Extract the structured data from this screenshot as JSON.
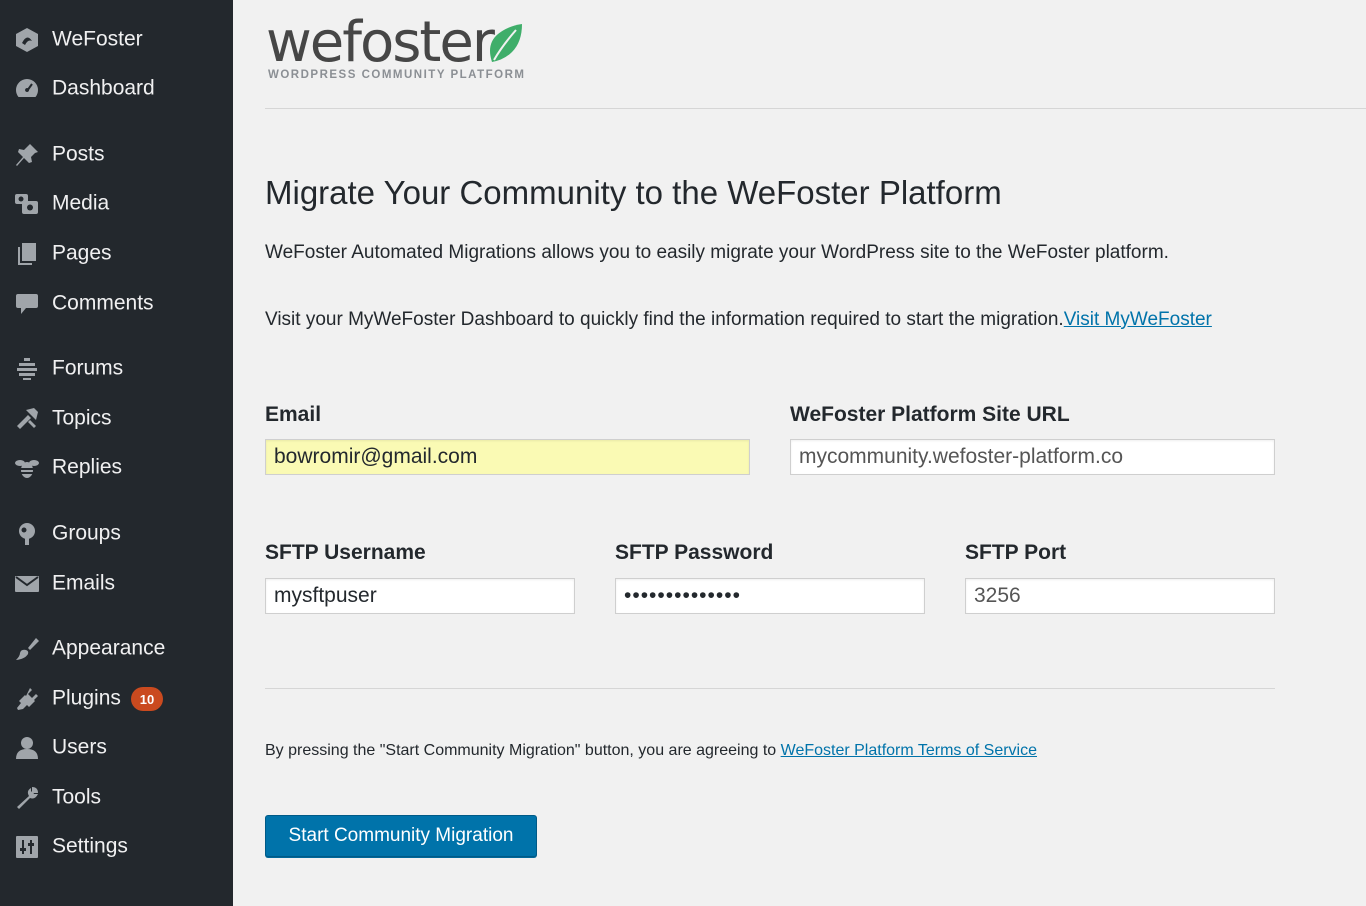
{
  "sidebar": {
    "items": [
      {
        "label": "WeFoster",
        "icon": "wefoster-hex-icon"
      },
      {
        "label": "Dashboard",
        "icon": "dashboard-gauge-icon"
      },
      {
        "label": "Posts",
        "icon": "pushpin-icon"
      },
      {
        "label": "Media",
        "icon": "media-camera-icon"
      },
      {
        "label": "Pages",
        "icon": "pages-icon"
      },
      {
        "label": "Comments",
        "icon": "comment-bubble-icon"
      },
      {
        "label": "Forums",
        "icon": "forums-stack-icon"
      },
      {
        "label": "Topics",
        "icon": "topics-tools-icon"
      },
      {
        "label": "Replies",
        "icon": "replies-bee-icon"
      },
      {
        "label": "Groups",
        "icon": "groups-icon"
      },
      {
        "label": "Emails",
        "icon": "envelope-icon"
      },
      {
        "label": "Appearance",
        "icon": "paintbrush-icon"
      },
      {
        "label": "Plugins",
        "icon": "plug-icon",
        "badge": "10"
      },
      {
        "label": "Users",
        "icon": "user-icon"
      },
      {
        "label": "Tools",
        "icon": "wrench-icon"
      },
      {
        "label": "Settings",
        "icon": "settings-sliders-icon"
      }
    ],
    "colors": {
      "background": "#23282d",
      "icon": "#a0a5aa",
      "text": "#f0f0f1",
      "badge": "#ca4a1f"
    }
  },
  "logo": {
    "wordmark": "wefoster",
    "tagline": "WORDPRESS COMMUNITY PLATFORM",
    "leaf_color": "#3fae6a"
  },
  "main": {
    "title": "Migrate Your Community to the WeFoster Platform",
    "intro": "WeFoster Automated Migrations allows you to easily migrate your WordPress site to the WeFoster platform.",
    "visit_text": "Visit your MyWeFoster Dashboard to quickly find the information required to start the migration.",
    "visit_link": "Visit MyWeFoster",
    "fields": {
      "email": {
        "label": "Email",
        "value": "bowromir@gmail.com"
      },
      "site_url": {
        "label": "WeFoster Platform Site URL",
        "placeholder": "mycommunity.wefoster-platform.co"
      },
      "sftp_username": {
        "label": "SFTP Username",
        "value": "mysftpuser"
      },
      "sftp_password": {
        "label": "SFTP Password",
        "value": "••••••••••••••"
      },
      "sftp_port": {
        "label": "SFTP Port",
        "placeholder": "3256"
      }
    },
    "terms_text": "By pressing the \"Start Community Migration\" button, you are agreeing to ",
    "terms_link": "WeFoster Platform Terms of Service",
    "start_button": "Start Community Migration",
    "colors": {
      "accent": "#0073aa",
      "autofill": "#fafab4",
      "background": "#f1f1f1"
    }
  }
}
